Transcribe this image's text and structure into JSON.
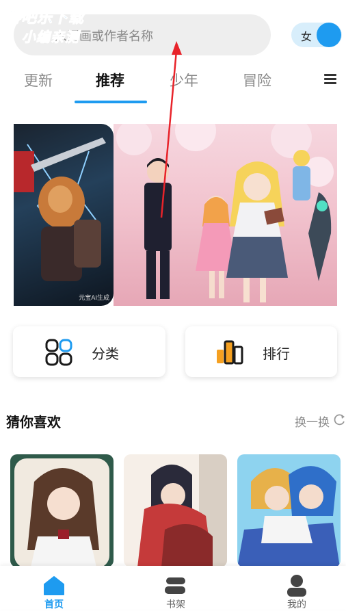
{
  "watermark": {
    "line1": "游吧乐下载",
    "line2": "小编亲测"
  },
  "search": {
    "placeholder": "入漫画或作者名称"
  },
  "gender_toggle": {
    "label": "女"
  },
  "tabs": [
    {
      "label": "更新"
    },
    {
      "label": "推荐"
    },
    {
      "label": "少年"
    },
    {
      "label": "冒险"
    }
  ],
  "banner": {
    "badge": "元宝AI生成"
  },
  "categories": [
    {
      "label": "分类"
    },
    {
      "label": "排行"
    }
  ],
  "section": {
    "title": "猜你喜欢",
    "refresh_label": "换一换"
  },
  "bottom_nav": [
    {
      "label": "首页"
    },
    {
      "label": "书架"
    },
    {
      "label": "我的"
    }
  ],
  "colors": {
    "accent": "#1e9bf0",
    "annotation": "#e8232a"
  },
  "icons": {
    "menu": "hamburger-menu-icon",
    "category": "four-petal-grid-icon",
    "ranking": "bar-ranking-icon",
    "refresh": "refresh-icon",
    "home": "home-icon",
    "bookshelf": "bookshelf-icon",
    "profile": "profile-icon"
  }
}
